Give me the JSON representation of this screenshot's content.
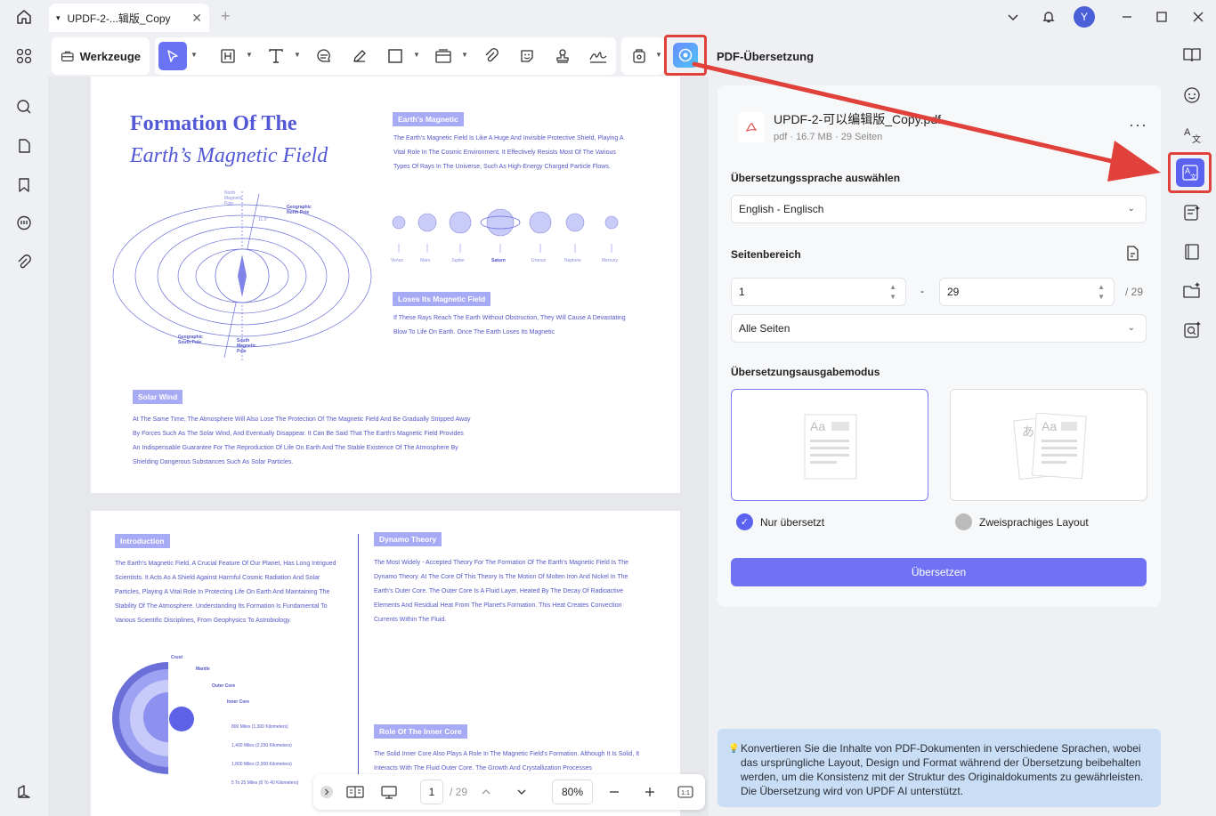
{
  "window": {
    "tab_title": "UPDF-2-...辑版_Copy",
    "tab_caret": "▾",
    "add_tab": "+",
    "avatar_initial": "Y"
  },
  "toolbar": {
    "tools_label": "Werkzeuge"
  },
  "document": {
    "page1": {
      "title_line1": "Formation Of The",
      "title_line2": "Earth’s Magnetic Field",
      "section_earth_label": "Earth's Magnetic",
      "section_earth_text": "The Earth's Magnetic Field Is Like A Huge And Invisible Protective Shield, Playing A Vital Role In The Cosmic Environment. It Effectively Resists Most Of The Various Types Of Rays In The Universe, Such As High-Energy Charged Particle Flows.",
      "planets": [
        "Venus",
        "Mars",
        "Jupiter",
        "Saturn",
        "Uranus",
        "Neptune",
        "Mercury"
      ],
      "section_loses_label": "Loses Its Magnetic Field",
      "section_loses_text": "If These Rays Reach The Earth Without Obstruction, They Will Cause A Devastating Blow To Life On Earth. Once The Earth Loses Its Magnetic",
      "diagram_labels": {
        "north_magnetic": "North Magnetic Pole",
        "geographic_north": "Geographic North Pole",
        "geographic_south": "Geographic South Pole",
        "south_magnetic": "South Magnetic Pole",
        "angle": "11.5°"
      },
      "section_solar_label": "Solar Wind",
      "section_solar_text": "At The Same Time, The Atmosphere Will Also Lose The Protection Of The Magnetic Field And Be Gradually Stripped Away By Forces Such As The Solar Wind, And Eventually Disappear. It Can Be Said That The Earth's Magnetic Field Provides An Indispensable Guarantee For The Reproduction Of Life On Earth And The Stable Existence Of The Atmosphere By Shielding Dangerous Substances Such As Solar Particles."
    },
    "page2": {
      "intro_label": "Introduction",
      "intro_text": "The Earth's Magnetic Field, A Crucial Feature Of Our Planet, Has Long Intrigued Scientists. It Acts As A Shield Against Harmful Cosmic Radiation And Solar Particles, Playing A Vital Role In Protecting Life On Earth And Maintaining The Stability Of The Atmosphere. Understanding Its Formation Is Fundamental To Various Scientific Disciplines, From Geophysics To Astrobiology.",
      "dynamo_label": "Dynamo Theory",
      "dynamo_text": "The Most Widely - Accepted Theory For The Formation Of The Earth's Magnetic Field Is The Dynamo Theory. At The Core Of This Theory Is The Motion Of Molten Iron And Nickel In The Earth's Outer Core. The Outer Core Is A Fluid Layer, Heated By The Decay Of Radioactive Elements And Residual Heat From The Planet's Formation. This Heat Creates Convection Currents Within The Fluid.",
      "layers": [
        "Crust",
        "Mantle",
        "Outer Core",
        "Inner Core"
      ],
      "distances": [
        "800 Miles (1,300 Kilometers)",
        "1,400 Miles (2,250 Kilometers)",
        "1,800 Miles (2,900 Kilometers)",
        "5 To 25 Miles (8 To 40 Kilometers)"
      ],
      "inner_core_label": "Role Of The Inner Core",
      "inner_core_text": "The Solid Inner Core Also Plays A Role In The Magnetic Field's Formation. Although It Is Solid, It Interacts With The Fluid Outer Core. The Growth And Crystallization Processes"
    }
  },
  "navbar": {
    "current_page": "1",
    "total_pages": "/ 29",
    "zoom": "80%"
  },
  "panel": {
    "title": "PDF-Übersetzung",
    "file_name": "UPDF-2-可以编辑版_Copy.pdf",
    "file_meta": "pdf · 16.7 MB · 29 Seiten",
    "more": "···",
    "language_label": "Übersetzungssprache auswählen",
    "language_value": "English - Englisch",
    "page_range_label": "Seitenbereich",
    "range_from": "1",
    "range_dash": "-",
    "range_to": "29",
    "range_total": "/ 29",
    "pages_value": "Alle Seiten",
    "output_mode_label": "Übersetzungsausgabemodus",
    "mode_translated_only": "Nur übersetzt",
    "mode_bilingual": "Zweisprachiges Layout",
    "translate_button": "Übersetzen",
    "info_text": "Konvertieren Sie die Inhalte von PDF-Dokumenten in verschiedene Sprachen, wobei das ursprüngliche Layout, Design und Format während der Übersetzung beibehalten werden, um die Konsistenz mit der Struktur des Originaldokuments zu gewährleisten. Die Übersetzung wird von UPDF AI unterstützt."
  },
  "colors": {
    "accent": "#6f73f3",
    "highlight_border": "#e0413a",
    "doc_text": "#5457c7",
    "label_bg": "#a7aaf5",
    "info_bg": "#c9def5"
  }
}
